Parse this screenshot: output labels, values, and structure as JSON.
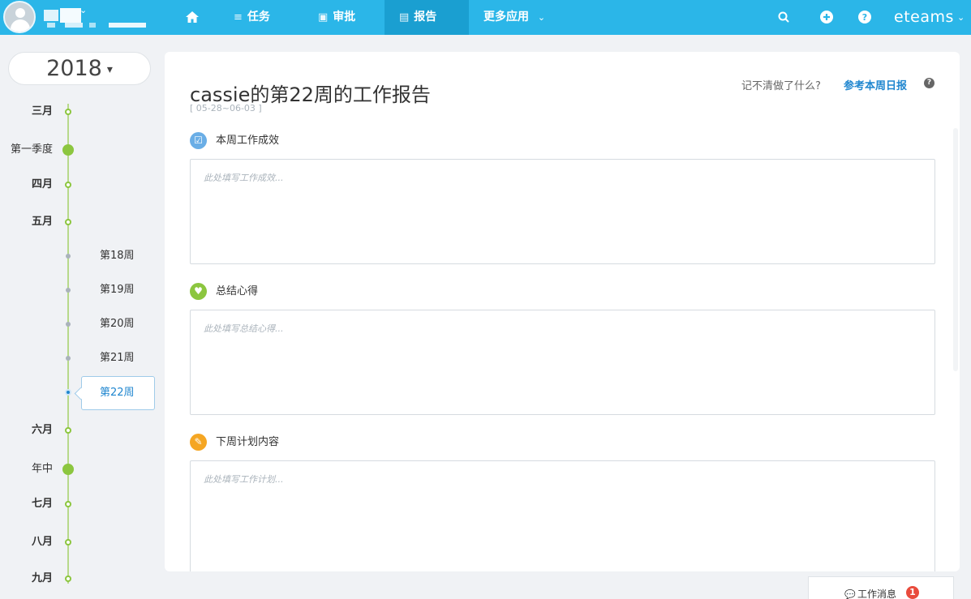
{
  "nav": {
    "items": [
      {
        "label": "任务",
        "icon": "list-icon"
      },
      {
        "label": "审批",
        "icon": "approval-icon"
      },
      {
        "label": "报告",
        "icon": "report-icon"
      },
      {
        "label": "更多应用",
        "icon": "chevron-down-icon"
      }
    ],
    "active": "报告",
    "brand": "eteams"
  },
  "timeline": {
    "year": "2018",
    "months": [
      "三月",
      "四月",
      "五月",
      "六月",
      "七月",
      "八月",
      "九月"
    ],
    "quarters": [
      "第一季度",
      "年中"
    ],
    "weeks": [
      "第18周",
      "第19周",
      "第20周",
      "第21周",
      "第22周"
    ],
    "active_week": "第22周"
  },
  "report": {
    "title": "cassie的第22周的工作报告",
    "date_range": "[ 05-28~06-03 ]",
    "hint": "记不清做了什么?",
    "ref_link": "参考本周日报",
    "sections": [
      {
        "title": "本周工作成效",
        "placeholder": "此处填写工作成效...",
        "icon": "checkbox-icon",
        "color": "#6aaee6"
      },
      {
        "title": "总结心得",
        "placeholder": "此处填写总结心得...",
        "icon": "heart-icon",
        "color": "#8cc63f"
      },
      {
        "title": "下周计划内容",
        "placeholder": "此处填写工作计划...",
        "icon": "pencil-icon",
        "color": "#f5a623"
      }
    ]
  },
  "messages": {
    "label": "工作消息",
    "count": "1"
  },
  "colors": {
    "topbar": "#2bb6e8",
    "topbar_active": "#1a9fd1",
    "timeline_green": "#8cc63f",
    "link_blue": "#1f86cf",
    "badge_red": "#e94b3c"
  }
}
